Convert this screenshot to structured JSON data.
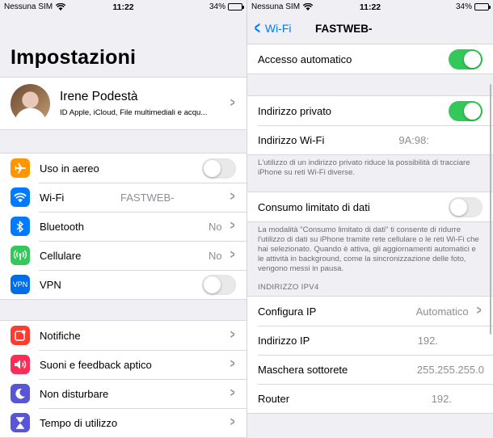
{
  "left": {
    "status": {
      "carrier": "Nessuna SIM",
      "time": "11:22",
      "battery": "34%"
    },
    "title": "Impostazioni",
    "profile": {
      "name": "Irene Podestà",
      "subtitle": "ID Apple, iCloud, File multimediali e acqu..."
    },
    "group1": [
      {
        "label": "Uso in aereo",
        "icon": "airplane-icon",
        "color": "#ff9500",
        "accessory": "toggle",
        "on": false
      },
      {
        "label": "Wi-Fi",
        "icon": "wifi-icon",
        "color": "#007aff",
        "value": "FASTWEB-",
        "accessory": "chevron"
      },
      {
        "label": "Bluetooth",
        "icon": "bluetooth-icon",
        "color": "#007aff",
        "value": "No",
        "accessory": "chevron"
      },
      {
        "label": "Cellulare",
        "icon": "cellular-icon",
        "color": "#34c759",
        "value": "No",
        "accessory": "chevron"
      },
      {
        "label": "VPN",
        "icon": "vpn-icon",
        "icon_text": "VPN",
        "color": "#006ee6",
        "accessory": "toggle",
        "on": false
      }
    ],
    "group2": [
      {
        "label": "Notifiche",
        "icon": "notifications-icon",
        "color": "#ff3b30"
      },
      {
        "label": "Suoni e feedback aptico",
        "icon": "sounds-icon",
        "color": "#ff2d55"
      },
      {
        "label": "Non disturbare",
        "icon": "moon-icon",
        "color": "#5856d6"
      },
      {
        "label": "Tempo di utilizzo",
        "icon": "hourglass-icon",
        "color": "#5856d6"
      }
    ]
  },
  "right": {
    "status": {
      "carrier": "Nessuna SIM",
      "time": "11:22",
      "battery": "34%"
    },
    "nav": {
      "back_label": "Wi-Fi",
      "title": "FASTWEB-"
    },
    "auto_join": {
      "label": "Accesso automatico",
      "on": true
    },
    "private": {
      "label": "Indirizzo privato",
      "on": true,
      "wifi_address_label": "Indirizzo Wi-Fi",
      "wifi_address_value": "9A:98:"
    },
    "private_note": "L'utilizzo di un indirizzo privato riduce la possibilità di tracciare iPhone su reti Wi-Fi diverse.",
    "low_data": {
      "label": "Consumo limitato di dati",
      "on": false
    },
    "low_data_note": "La modalità \"Consumo limitato di dati\" ti consente di ridurre l'utilizzo di dati su iPhone tramite rete cellulare o le reti Wi-Fi che hai selezionato. Quando è attiva, gli aggiornamenti automatici e le attività in background, come la sincronizzazione delle foto, vengono messi in pausa.",
    "ipv4_header": "INDIRIZZO IPV4",
    "ipv4": [
      {
        "label": "Configura IP",
        "value": "Automatico",
        "chevron": true
      },
      {
        "label": "Indirizzo IP",
        "value": "192.",
        "chevron": false
      },
      {
        "label": "Maschera sottorete",
        "value": "255.255.255.0",
        "chevron": false
      },
      {
        "label": "Router",
        "value": "192.",
        "chevron": false
      }
    ]
  }
}
